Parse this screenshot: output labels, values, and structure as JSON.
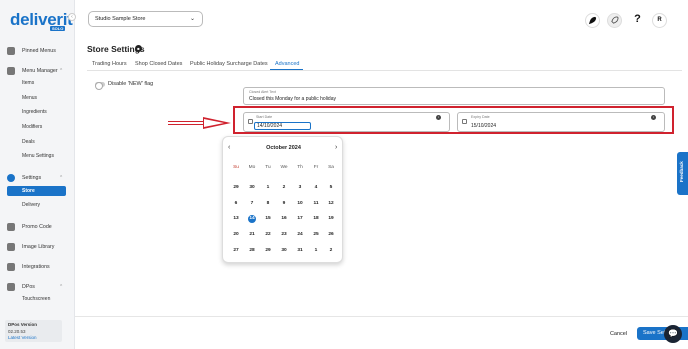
{
  "brand": {
    "logo": "deliverit",
    "logo_sub": "SOLO"
  },
  "sidebar": {
    "items": [
      {
        "label": "Pinned Menus"
      },
      {
        "label": "Menu Manager"
      },
      {
        "label": "Settings"
      },
      {
        "label": "Promo Code"
      },
      {
        "label": "Image Library"
      },
      {
        "label": "Integrations"
      },
      {
        "label": "DPos"
      }
    ],
    "menu_manager_sub": [
      "Items",
      "Menus",
      "Ingredients",
      "Modifiers",
      "Deals",
      "Menu Settings"
    ],
    "settings_sub": [
      "Store",
      "Delivery"
    ],
    "dpos_sub": [
      "Touchscreen"
    ],
    "version": {
      "label": "DPos Version",
      "number": "02.20.53",
      "link": "Latest Version"
    }
  },
  "header": {
    "store": "Studio Sample Store",
    "avatar": "R",
    "help": "?"
  },
  "page": {
    "title": "Store Settings",
    "tabs": [
      {
        "label": "Trading Hours"
      },
      {
        "label": "Shop Closed Dates"
      },
      {
        "label": "Public Holiday Surcharge Dates"
      },
      {
        "label": "Advanced"
      }
    ]
  },
  "advanced": {
    "toggle_label": "Disable 'NEW' flag",
    "alert_label": "Closed Alert Text",
    "alert_value": "Closed this Monday for a public holiday",
    "start_label": "Start Date",
    "start_value": "14/10/2024",
    "expiry_label": "Expiry Date",
    "expiry_value": "15/10/2024"
  },
  "calendar": {
    "title": "October 2024",
    "dows": [
      "Su",
      "Mo",
      "Tu",
      "We",
      "Th",
      "Fr",
      "Sa"
    ],
    "weeks": [
      [
        "29",
        "30",
        "1",
        "2",
        "3",
        "4",
        "5"
      ],
      [
        "6",
        "7",
        "8",
        "9",
        "10",
        "11",
        "12"
      ],
      [
        "13",
        "14",
        "15",
        "16",
        "17",
        "18",
        "19"
      ],
      [
        "20",
        "21",
        "22",
        "23",
        "24",
        "25",
        "26"
      ],
      [
        "27",
        "28",
        "29",
        "30",
        "31",
        "1",
        "2"
      ]
    ],
    "selected": "14"
  },
  "footer": {
    "cancel": "Cancel",
    "save": "Save Sett"
  },
  "feedback": "Feedback",
  "colors": {
    "accent": "#1a73c8",
    "highlight": "#d0222e"
  }
}
